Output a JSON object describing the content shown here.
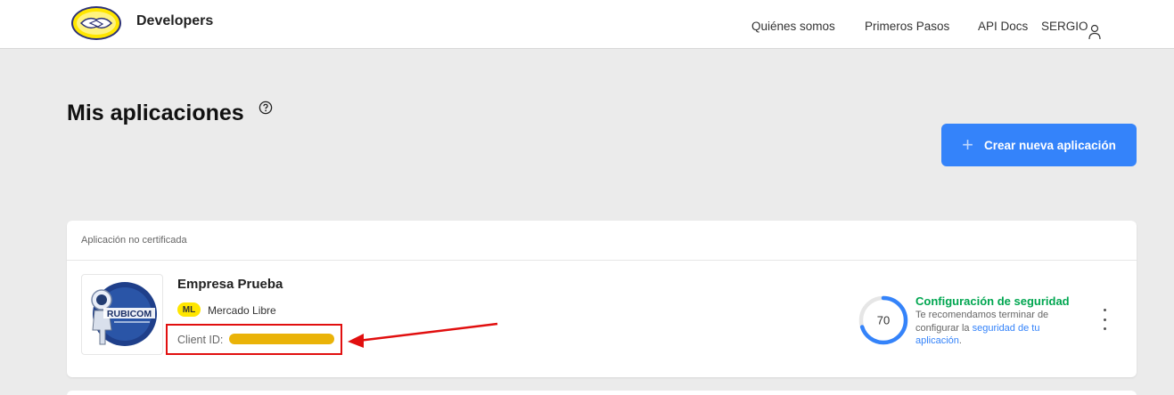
{
  "header": {
    "brand": "Developers",
    "nav": [
      "Quiénes somos",
      "Primeros Pasos",
      "API Docs"
    ],
    "user_name": "SERGIO"
  },
  "page": {
    "title": "Mis aplicaciones",
    "create_button": "Crear nueva aplicación"
  },
  "app_card": {
    "section_label": "Aplicación no certificada",
    "thumb_text": "RUBICOM",
    "name": "Empresa Prueba",
    "site_badge": "ML",
    "site_name": "Mercado Libre",
    "client_id_label": "Client ID:",
    "security": {
      "score": "70",
      "score_fraction": 0.7,
      "title": "Configuración de seguridad",
      "text": "Te recomendamos terminar de configurar la",
      "link": "seguridad de tu aplicación",
      "trail": "."
    }
  },
  "colors": {
    "accent": "#3483fa",
    "success": "#00a650",
    "badge": "#ffe600",
    "annotation": "#e10f0f"
  }
}
